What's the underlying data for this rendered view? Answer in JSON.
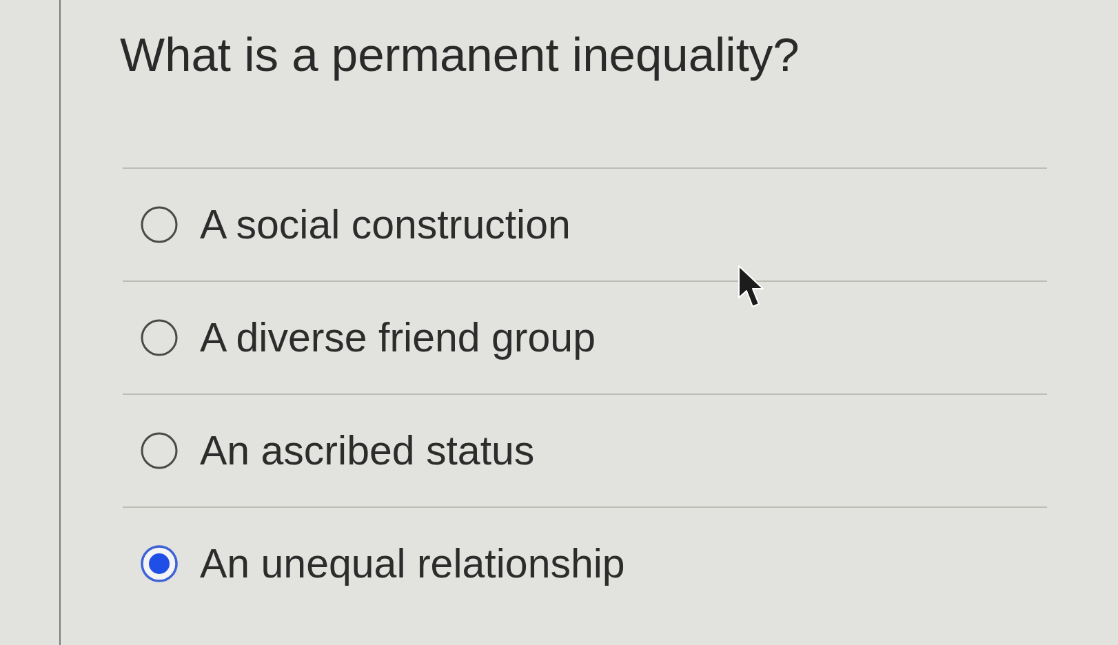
{
  "question": "What is a permanent inequality?",
  "options": [
    {
      "label": "A social construction",
      "selected": false
    },
    {
      "label": "A diverse friend group",
      "selected": false
    },
    {
      "label": "An ascribed status",
      "selected": false
    },
    {
      "label": "An unequal relationship",
      "selected": true
    }
  ]
}
